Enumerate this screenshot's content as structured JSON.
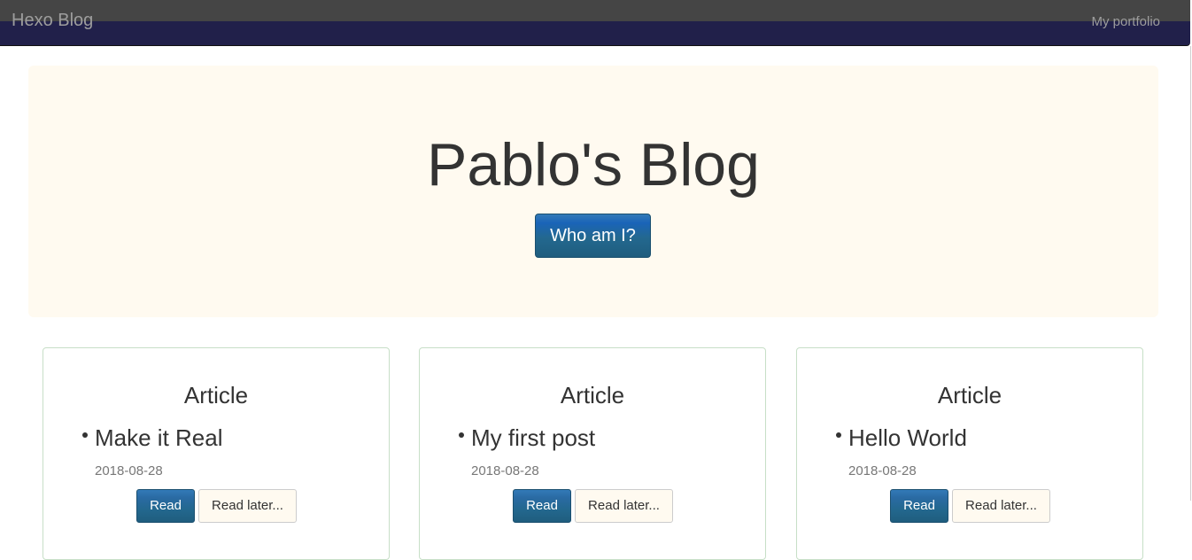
{
  "navbar": {
    "brand": "Hexo Blog",
    "link": "My portfolio"
  },
  "hero": {
    "title": "Pablo's Blog",
    "button_label": "Who am I?"
  },
  "cards": [
    {
      "heading": "Article",
      "post_title": "Make it Real",
      "date": "2018-08-28",
      "read_label": "Read",
      "later_label": "Read later..."
    },
    {
      "heading": "Article",
      "post_title": "My first post",
      "date": "2018-08-28",
      "read_label": "Read",
      "later_label": "Read later..."
    },
    {
      "heading": "Article",
      "post_title": "Hello World",
      "date": "2018-08-28",
      "read_label": "Read",
      "later_label": "Read later..."
    }
  ],
  "colors": {
    "navbar_top": "#454545",
    "navbar_bottom": "#21204a",
    "jumbotron_bg": "#fffaf0",
    "primary_button": "#23688f",
    "card_border": "#c7dfc7"
  }
}
